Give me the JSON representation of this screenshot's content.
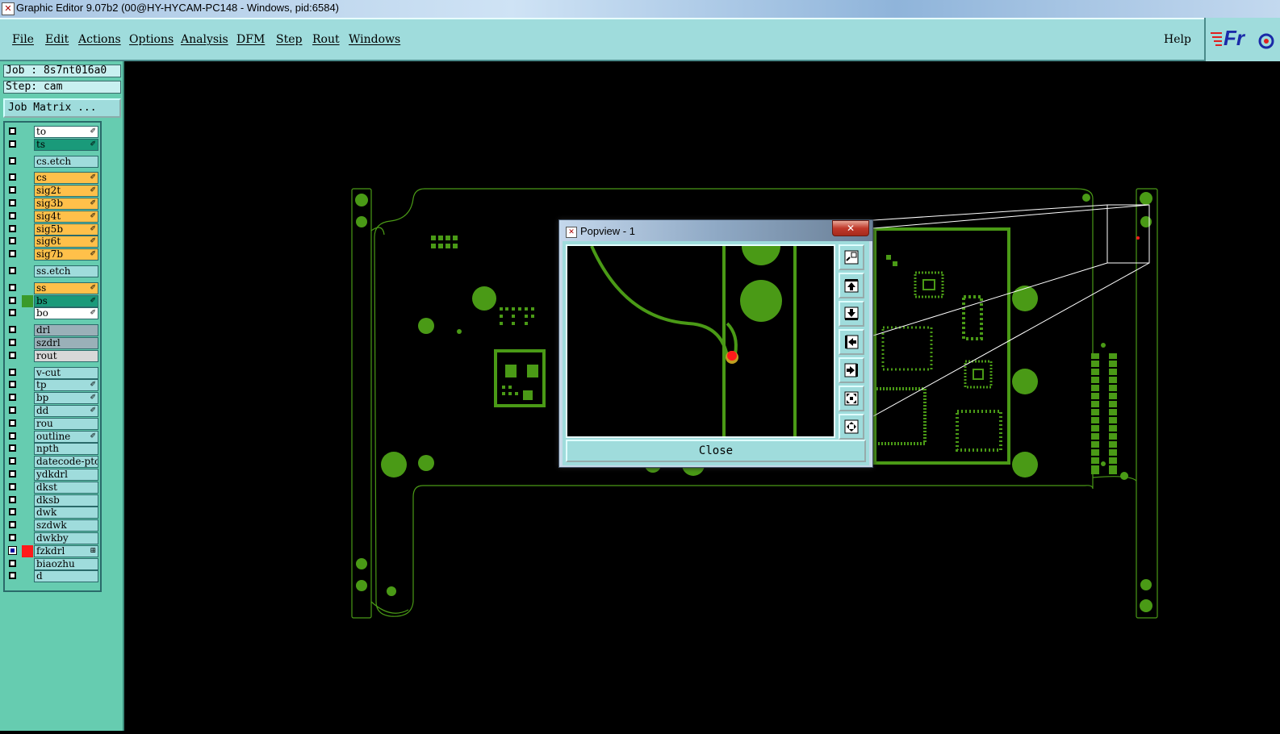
{
  "window": {
    "title": "Graphic Editor 9.07b2 (00@HY-HYCAM-PC148 - Windows, pid:6584)"
  },
  "menu": {
    "items": [
      "File",
      "Edit",
      "Actions",
      "Options",
      "Analysis",
      "DFM",
      "Step",
      "Rout",
      "Windows"
    ],
    "help": "Help"
  },
  "logo": {
    "text": "Fr"
  },
  "job": {
    "job_label": "Job : 8s7nt016a0",
    "step_label": "Step: cam",
    "matrix_button": "Job Matrix ..."
  },
  "layers": [
    {
      "name": "to",
      "color": "#ffffff",
      "mark": "✐"
    },
    {
      "name": "ts",
      "color": "#1a9a7a",
      "mark": "✐"
    },
    {
      "name": "cs.etch",
      "color": "#9fdcdc",
      "mark": ""
    },
    {
      "name": "cs",
      "color": "#ffc04a",
      "mark": "✐"
    },
    {
      "name": "sig2t",
      "color": "#ffc04a",
      "mark": "✐"
    },
    {
      "name": "sig3b",
      "color": "#ffc04a",
      "mark": "✐"
    },
    {
      "name": "sig4t",
      "color": "#ffc04a",
      "mark": "✐"
    },
    {
      "name": "sig5b",
      "color": "#ffc04a",
      "mark": "✐"
    },
    {
      "name": "sig6t",
      "color": "#ffc04a",
      "mark": "✐"
    },
    {
      "name": "sig7b",
      "color": "#ffc04a",
      "mark": "✐"
    },
    {
      "name": "ss.etch",
      "color": "#9fdcdc",
      "mark": ""
    },
    {
      "name": "ss",
      "color": "#ffc04a",
      "mark": "✐"
    },
    {
      "name": "bs",
      "color": "#1a9a7a",
      "mark": "✐",
      "swatch": "#3a9a2a"
    },
    {
      "name": "bo",
      "color": "#ffffff",
      "mark": "✐"
    },
    {
      "name": "drl",
      "color": "#9ab0b8",
      "mark": ""
    },
    {
      "name": "szdrl",
      "color": "#9ab0b8",
      "mark": ""
    },
    {
      "name": "rout",
      "color": "#d8d8d8",
      "mark": ""
    },
    {
      "name": "v-cut",
      "color": "#9fdcdc",
      "mark": ""
    },
    {
      "name": "tp",
      "color": "#9fdcdc",
      "mark": "✐"
    },
    {
      "name": "bp",
      "color": "#9fdcdc",
      "mark": "✐"
    },
    {
      "name": "dd",
      "color": "#9fdcdc",
      "mark": "✐"
    },
    {
      "name": "rou",
      "color": "#9fdcdc",
      "mark": ""
    },
    {
      "name": "outline",
      "color": "#9fdcdc",
      "mark": "✐"
    },
    {
      "name": "npth",
      "color": "#9fdcdc",
      "mark": ""
    },
    {
      "name": "datecode-ptc",
      "color": "#9fdcdc",
      "mark": ""
    },
    {
      "name": "ydkdrl",
      "color": "#9fdcdc",
      "mark": ""
    },
    {
      "name": "dkst",
      "color": "#9fdcdc",
      "mark": ""
    },
    {
      "name": "dksb",
      "color": "#9fdcdc",
      "mark": ""
    },
    {
      "name": "dwk",
      "color": "#9fdcdc",
      "mark": ""
    },
    {
      "name": "szdwk",
      "color": "#9fdcdc",
      "mark": ""
    },
    {
      "name": "dwkby",
      "color": "#9fdcdc",
      "mark": ""
    },
    {
      "name": "fzkdrl",
      "color": "#9fdcdc",
      "mark": "⊞",
      "swatch": "#ff1a1a",
      "checkbox": "blue"
    },
    {
      "name": "biaozhu",
      "color": "#9fdcdc",
      "mark": ""
    },
    {
      "name": "d",
      "color": "#9fdcdc",
      "mark": ""
    }
  ],
  "popview": {
    "title": "Popview - 1",
    "close_button": "Close",
    "tools": [
      "zoom-in-icon",
      "pan-up-icon",
      "pan-down-icon",
      "pan-left-icon",
      "pan-right-icon",
      "zoom-fit-icon",
      "zoom-out-icon"
    ]
  },
  "colors": {
    "accent": "#9fdcdc",
    "panel": "#66ccb0",
    "pcb_green": "#4a9a16",
    "highlight": "#ff1a1a"
  }
}
